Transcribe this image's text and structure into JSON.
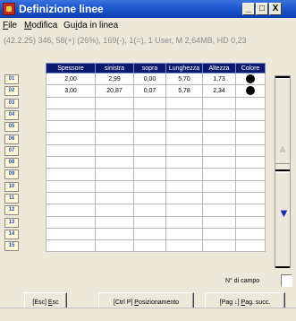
{
  "window": {
    "title": "Definizione linee",
    "min_label": "_",
    "max_label": "□",
    "close_label": "X"
  },
  "menu": [
    {
      "label": "File",
      "mnemonic": "F"
    },
    {
      "label": "Modifica",
      "mnemonic": "M"
    },
    {
      "label": "Guida in linea",
      "mnemonic": "i"
    }
  ],
  "info_line": "(42.2.25) 346, 58(+) (26%), 169(-), 1(=), 1 User, M 2,64MB, HD 0,23",
  "grid": {
    "headers": [
      "Spessore",
      "sinistra",
      "sopra",
      "Lunghezza",
      "Altezza",
      "Colore"
    ],
    "row_numbers": [
      "01",
      "02",
      "03",
      "04",
      "05",
      "06",
      "07",
      "08",
      "09",
      "10",
      "11",
      "12",
      "13",
      "14",
      "15"
    ],
    "rows": [
      [
        "2,00",
        "2,99",
        "0,00",
        "5,70",
        "1,73",
        "black-dot"
      ],
      [
        "3,00",
        "20,87",
        "0,07",
        "5,78",
        "2,34",
        "black-dot"
      ],
      [
        "",
        "",
        "",
        "",
        "",
        ""
      ],
      [
        "",
        "",
        "",
        "",
        "",
        ""
      ],
      [
        "",
        "",
        "",
        "",
        "",
        ""
      ],
      [
        "",
        "",
        "",
        "",
        "",
        ""
      ],
      [
        "",
        "",
        "",
        "",
        "",
        ""
      ],
      [
        "",
        "",
        "",
        "",
        "",
        ""
      ],
      [
        "",
        "",
        "",
        "",
        "",
        ""
      ],
      [
        "",
        "",
        "",
        "",
        "",
        ""
      ],
      [
        "",
        "",
        "",
        "",
        "",
        ""
      ],
      [
        "",
        "",
        "",
        "",
        "",
        ""
      ],
      [
        "",
        "",
        "",
        "",
        "",
        ""
      ],
      [
        "",
        "",
        "",
        "",
        "",
        ""
      ],
      [
        "",
        "",
        "",
        "",
        "",
        ""
      ]
    ]
  },
  "scrollbar": {
    "up_icon": "up-arrow-icon",
    "down_icon": "down-arrow-icon"
  },
  "campo": {
    "label": "N° di campo",
    "value": ""
  },
  "buttons": {
    "esc": "[Esc] Esc",
    "posizionamento": "[Ctrl P] Posizionamento",
    "pag_succ": "[Pag ↓] Pag. succ."
  },
  "colors": {
    "titlebar": "#1e59cf",
    "header_bg": "#0c1a6e",
    "row_number_text": "#2f4fa6",
    "window_bg": "#ece9d8",
    "down_arrow": "#1b24b8"
  }
}
